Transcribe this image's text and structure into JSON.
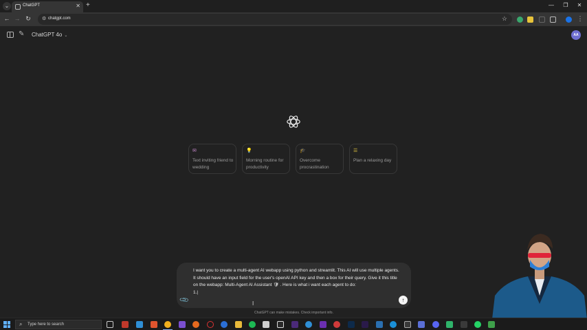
{
  "browser": {
    "tab_title": "ChatGPT",
    "url": "chatgpt.com"
  },
  "header": {
    "model_label": "ChatGPT 4o",
    "avatar_initials": "AA"
  },
  "suggestions": [
    {
      "label": "Text inviting friend to wedding",
      "icon": "envelope-icon",
      "color": "#cb8bd0"
    },
    {
      "label": "Morning routine for productivity",
      "icon": "lightbulb-icon",
      "color": "#e2c541"
    },
    {
      "label": "Overcome procrastination",
      "icon": "graduation-cap-icon",
      "color": "#35c8e0"
    },
    {
      "label": "Plan a relaxing day",
      "icon": "list-icon",
      "color": "#e2c541"
    }
  ],
  "composer": {
    "text": "I want you to create a multi-agent AI webapp using python and streamlit. This AI will use multiple agents. It should have an input field for the user's openAI API key and then a box for their query. Give it this title on the webapp: Multi-Agent AI Assistant 🛡 . Here is what i want each agent to do:\n1.|"
  },
  "disclaimer": "ChatGPT can make mistakes. Check important info.",
  "taskbar": {
    "search_placeholder": "Type here to search"
  },
  "colors": {
    "background": "#212121",
    "composer": "#2f2f2f",
    "accent": "#6f6fd1"
  }
}
